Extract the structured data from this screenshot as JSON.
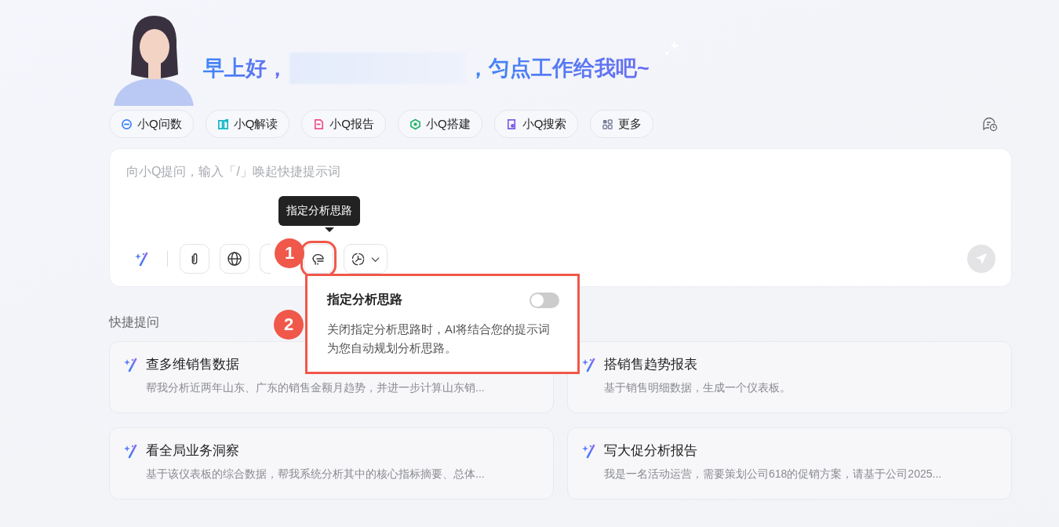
{
  "greeting": {
    "prefix": "早上好，",
    "name_redacted": true,
    "suffix": "，匀点工作给我吧~"
  },
  "chips": [
    {
      "label": "小Q问数",
      "kind": "chat",
      "color": "#3b82f6"
    },
    {
      "label": "小Q解读",
      "kind": "book",
      "color": "#14b8c4"
    },
    {
      "label": "小Q报告",
      "kind": "doc",
      "color": "#f0508a"
    },
    {
      "label": "小Q搭建",
      "kind": "build",
      "color": "#22b36b"
    },
    {
      "label": "小Q搜索",
      "kind": "search",
      "color": "#7c5ce6"
    },
    {
      "label": "更多",
      "kind": "grid",
      "color": "#7a7f9a"
    }
  ],
  "input": {
    "placeholder": "向小Q提问，输入「/」唤起快捷提示词"
  },
  "tools": [
    {
      "kind": "attach",
      "highlighted": false
    },
    {
      "kind": "globe",
      "highlighted": false
    },
    {
      "kind": "blank",
      "highlighted": false
    },
    {
      "kind": "thinking",
      "highlighted": true
    },
    {
      "kind": "model",
      "highlighted": false
    }
  ],
  "tooltip": {
    "text": "指定分析思路"
  },
  "annotations": [
    {
      "label": "1"
    },
    {
      "label": "2"
    }
  ],
  "popover": {
    "title": "指定分析思路",
    "on": false,
    "description": "关闭指定分析思路时，AI将结合您的提示词为您自动规划分析思路。"
  },
  "quick": {
    "title": "快捷提问",
    "cards": [
      {
        "title": "查多维销售数据",
        "description": "帮我分析近两年山东、广东的销售金额月趋势，并进一步计算山东销..."
      },
      {
        "title": "搭销售趋势报表",
        "description": "基于销售明细数据，生成一个仪表板。"
      },
      {
        "title": "看全局业务洞察",
        "description": "基于该仪表板的综合数据，帮我系统分析其中的核心指标摘要、总体..."
      },
      {
        "title": "写大促分析报告",
        "description": "我是一名活动运营，需要策划公司618的促销方案，请基于公司2025..."
      }
    ]
  }
}
